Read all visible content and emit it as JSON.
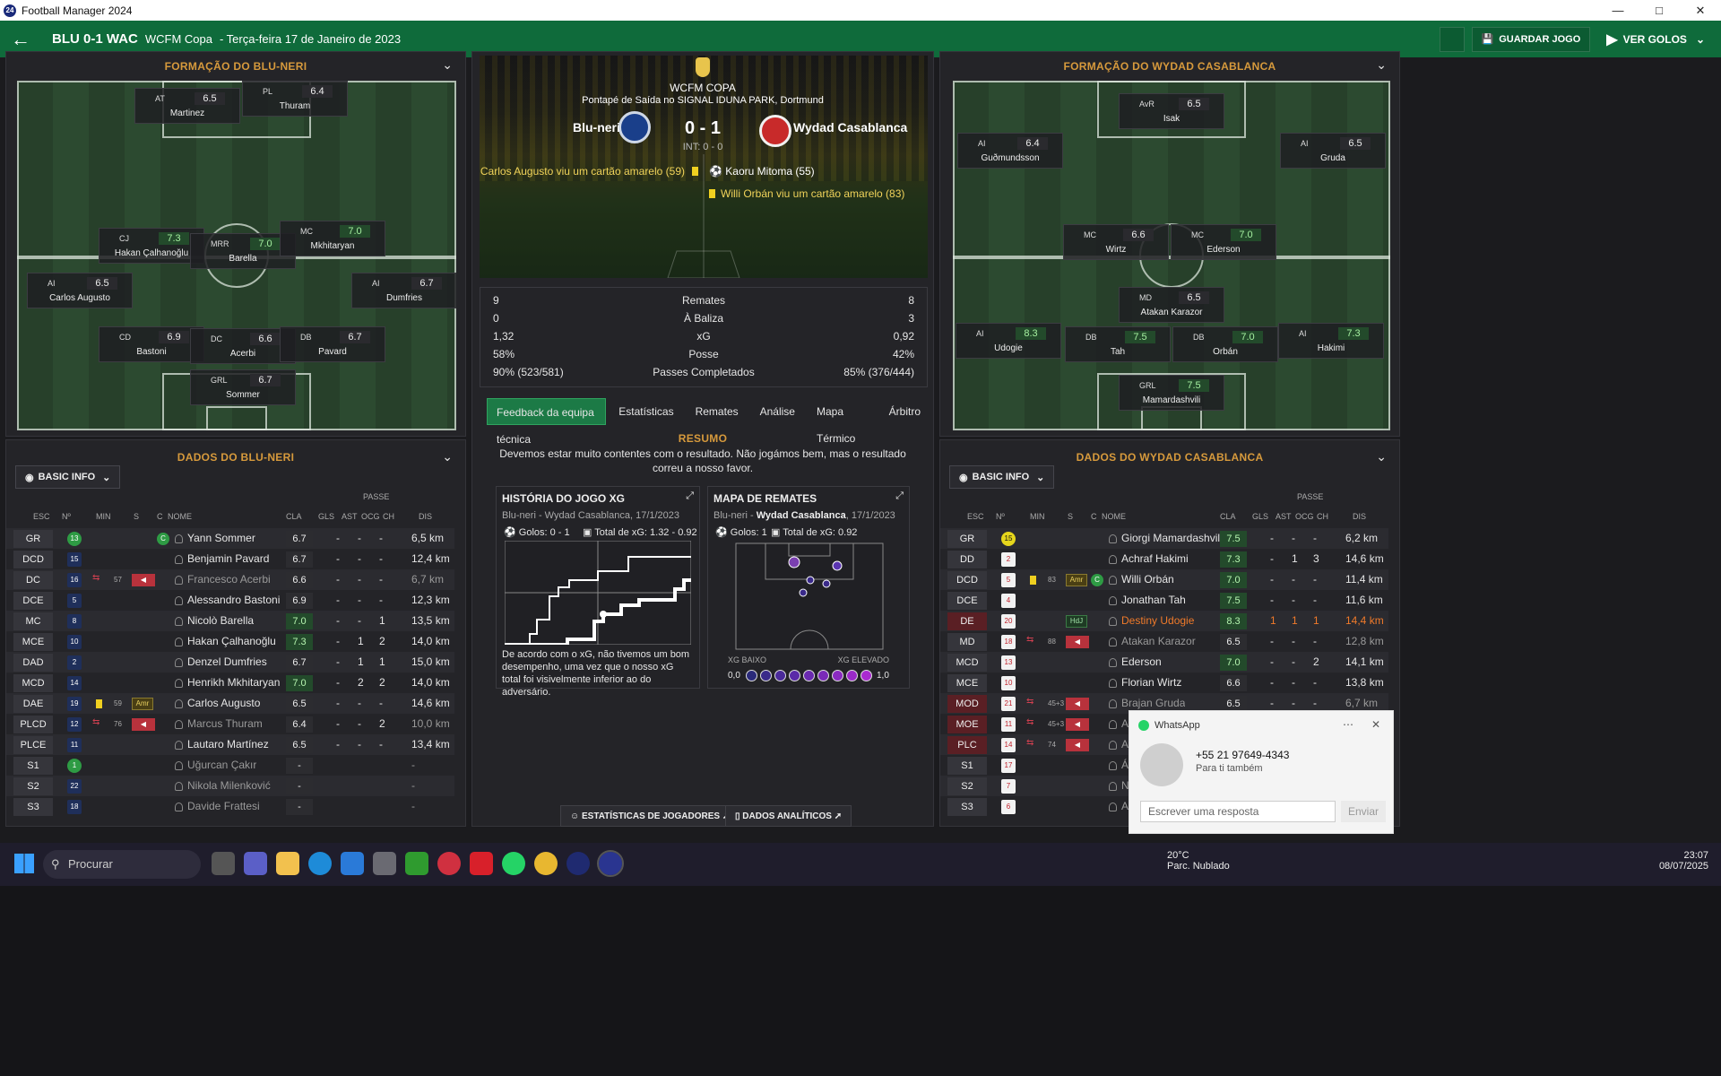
{
  "window": {
    "title": "Football Manager 2024",
    "app_icon": "24"
  },
  "header": {
    "score": "BLU 0-1 WAC",
    "competition": "WCFM Copa",
    "date": "- Terça-feira 17 de Janeiro de 2023",
    "save_label": "GUARDAR JOGO",
    "goals_label": "VER GOLOS"
  },
  "left": {
    "formation_title": "FORMAÇÃO DO BLU-NERI",
    "data_title": "DADOS DO BLU-NERI",
    "basic_info": "BASIC INFO",
    "players": [
      {
        "pos": "AT",
        "rating": "6.5",
        "name": "Martinez",
        "good": false
      },
      {
        "pos": "PL",
        "rating": "6.4",
        "name": "Thuram",
        "good": false
      },
      {
        "pos": "CJ",
        "rating": "7.3",
        "name": "Hakan Çalhanoğlu",
        "good": true
      },
      {
        "pos": "MRR",
        "rating": "7.0",
        "name": "Barella",
        "good": true
      },
      {
        "pos": "MC",
        "rating": "7.0",
        "name": "Mkhitaryan",
        "good": true
      },
      {
        "pos": "AI",
        "rating": "6.5",
        "name": "Carlos Augusto",
        "good": false
      },
      {
        "pos": "AI",
        "rating": "6.7",
        "name": "Dumfries",
        "good": false
      },
      {
        "pos": "CD",
        "rating": "6.9",
        "name": "Bastoni",
        "good": false
      },
      {
        "pos": "DC",
        "rating": "6.6",
        "name": "Acerbi",
        "good": false
      },
      {
        "pos": "DB",
        "rating": "6.7",
        "name": "Pavard",
        "good": false
      },
      {
        "pos": "GRL",
        "rating": "6.7",
        "name": "Sommer",
        "good": false
      }
    ],
    "columns": {
      "esc": "ESC",
      "n": "Nº",
      "min": "MIN",
      "s": "S",
      "c": "C",
      "nome": "NOME",
      "cla": "CLA",
      "gls": "GLS",
      "ast": "AST",
      "passe": "PASSE",
      "ocg": "OCG",
      "ch": "CH",
      "dis": "DIS"
    },
    "rows": [
      {
        "esc": "GR",
        "n": "13",
        "min": "",
        "cla": "6.7",
        "gls": "-",
        "ast": "-",
        "ocg": "-",
        "dis": "6,5 km",
        "name": "Yann Sommer",
        "sub": false,
        "yellow": false,
        "tag": "",
        "c": true,
        "gk": true,
        "red": false,
        "dim": false
      },
      {
        "esc": "DCD",
        "n": "15",
        "min": "",
        "cla": "6.7",
        "gls": "-",
        "ast": "-",
        "ocg": "-",
        "dis": "12,4 km",
        "name": "Benjamin Pavard",
        "sub": false,
        "yellow": false,
        "tag": "",
        "c": false,
        "gk": false,
        "red": false,
        "dim": false
      },
      {
        "esc": "DC",
        "n": "16",
        "min": "57",
        "cla": "6.6",
        "gls": "-",
        "ast": "-",
        "ocg": "-",
        "dis": "6,7 km",
        "name": "Francesco Acerbi",
        "sub": true,
        "yellow": false,
        "tag": "",
        "c": false,
        "gk": false,
        "red": false,
        "dim": true
      },
      {
        "esc": "DCE",
        "n": "5",
        "min": "",
        "cla": "6.9",
        "gls": "-",
        "ast": "-",
        "ocg": "-",
        "dis": "12,3 km",
        "name": "Alessandro Bastoni",
        "sub": false,
        "yellow": false,
        "tag": "",
        "c": false,
        "gk": false,
        "red": false,
        "dim": false
      },
      {
        "esc": "MC",
        "n": "8",
        "min": "",
        "cla": "7.0",
        "gls": "-",
        "ast": "-",
        "ocg": "1",
        "dis": "13,5 km",
        "name": "Nicolò Barella",
        "sub": false,
        "yellow": false,
        "tag": "",
        "c": false,
        "gk": false,
        "red": false,
        "dim": false
      },
      {
        "esc": "MCE",
        "n": "10",
        "min": "",
        "cla": "7.3",
        "gls": "-",
        "ast": "1",
        "ocg": "2",
        "dis": "14,0 km",
        "name": "Hakan Çalhanoğlu",
        "sub": false,
        "yellow": false,
        "tag": "",
        "c": false,
        "gk": false,
        "red": false,
        "dim": false
      },
      {
        "esc": "DAD",
        "n": "2",
        "min": "",
        "cla": "6.7",
        "gls": "-",
        "ast": "1",
        "ocg": "1",
        "dis": "15,0 km",
        "name": "Denzel Dumfries",
        "sub": false,
        "yellow": false,
        "tag": "",
        "c": false,
        "gk": false,
        "red": false,
        "dim": false
      },
      {
        "esc": "MCD",
        "n": "14",
        "min": "",
        "cla": "7.0",
        "gls": "-",
        "ast": "2",
        "ocg": "2",
        "dis": "14,0 km",
        "name": "Henrikh Mkhitaryan",
        "sub": false,
        "yellow": false,
        "tag": "",
        "c": false,
        "gk": false,
        "red": false,
        "dim": false
      },
      {
        "esc": "DAE",
        "n": "19",
        "min": "59",
        "cla": "6.5",
        "gls": "-",
        "ast": "-",
        "ocg": "-",
        "dis": "14,6 km",
        "name": "Carlos Augusto",
        "sub": false,
        "yellow": true,
        "tag": "Amr",
        "c": false,
        "gk": false,
        "red": false,
        "dim": false
      },
      {
        "esc": "PLCD",
        "n": "12",
        "min": "76",
        "cla": "6.4",
        "gls": "-",
        "ast": "-",
        "ocg": "2",
        "dis": "10,0 km",
        "name": "Marcus Thuram",
        "sub": true,
        "yellow": false,
        "tag": "",
        "c": false,
        "gk": false,
        "red": false,
        "dim": true
      },
      {
        "esc": "PLCE",
        "n": "11",
        "min": "",
        "cla": "6.5",
        "gls": "-",
        "ast": "-",
        "ocg": "-",
        "dis": "13,4 km",
        "name": "Lautaro Martínez",
        "sub": false,
        "yellow": false,
        "tag": "",
        "c": false,
        "gk": false,
        "red": false,
        "dim": false
      },
      {
        "esc": "S1",
        "n": "1",
        "min": "",
        "cla": "-",
        "gls": "",
        "ast": "",
        "ocg": "",
        "dis": "-",
        "name": "Uğurcan Çakır",
        "sub": false,
        "yellow": false,
        "tag": "",
        "c": false,
        "gk": true,
        "red": false,
        "dim": true
      },
      {
        "esc": "S2",
        "n": "22",
        "min": "",
        "cla": "-",
        "gls": "",
        "ast": "",
        "ocg": "",
        "dis": "-",
        "name": "Nikola Milenković",
        "sub": false,
        "yellow": false,
        "tag": "",
        "c": false,
        "gk": false,
        "red": false,
        "dim": true
      },
      {
        "esc": "S3",
        "n": "18",
        "min": "",
        "cla": "-",
        "gls": "",
        "ast": "",
        "ocg": "",
        "dis": "-",
        "name": "Davide Frattesi",
        "sub": false,
        "yellow": false,
        "tag": "",
        "c": false,
        "gk": false,
        "red": false,
        "dim": true
      }
    ]
  },
  "right": {
    "formation_title": "FORMAÇÃO DO WYDAD CASABLANCA",
    "data_title": "DADOS DO WYDAD CASABLANCA",
    "basic_info": "BASIC INFO",
    "players": [
      {
        "pos": "AvR",
        "rating": "6.5",
        "name": "Isak",
        "good": false
      },
      {
        "pos": "AI",
        "rating": "6.4",
        "name": "Guðmundsson",
        "good": false
      },
      {
        "pos": "AI",
        "rating": "6.5",
        "name": "Gruda",
        "good": false
      },
      {
        "pos": "MC",
        "rating": "6.6",
        "name": "Wirtz",
        "good": false
      },
      {
        "pos": "MC",
        "rating": "7.0",
        "name": "Ederson",
        "good": true
      },
      {
        "pos": "MD",
        "rating": "6.5",
        "name": "Atakan Karazor",
        "good": false
      },
      {
        "pos": "AI",
        "rating": "8.3",
        "name": "Udogie",
        "good": true
      },
      {
        "pos": "DB",
        "rating": "7.5",
        "name": "Tah",
        "good": true
      },
      {
        "pos": "DB",
        "rating": "7.0",
        "name": "Orbán",
        "good": true
      },
      {
        "pos": "AI",
        "rating": "7.3",
        "name": "Hakimi",
        "good": true
      },
      {
        "pos": "GRL",
        "rating": "7.5",
        "name": "Mamardashvili",
        "good": true
      }
    ],
    "rows": [
      {
        "esc": "GR",
        "n": "15",
        "min": "",
        "cla": "7.5",
        "gls": "-",
        "ast": "-",
        "ocg": "-",
        "dis": "6,2 km",
        "name": "Giorgi Mamardashvili",
        "sub": false,
        "yellow": false,
        "tag": "",
        "c": false,
        "gk": true,
        "red": false,
        "dim": false,
        "orange": false
      },
      {
        "esc": "DD",
        "n": "2",
        "min": "",
        "cla": "7.3",
        "gls": "-",
        "ast": "1",
        "ocg": "3",
        "dis": "14,6 km",
        "name": "Achraf Hakimi",
        "sub": false,
        "yellow": false,
        "tag": "",
        "c": false,
        "gk": false,
        "red": false,
        "dim": false,
        "orange": false
      },
      {
        "esc": "DCD",
        "n": "5",
        "min": "83",
        "cla": "7.0",
        "gls": "-",
        "ast": "-",
        "ocg": "-",
        "dis": "11,4 km",
        "name": "Willi Orbán",
        "sub": false,
        "yellow": true,
        "tag": "Amr",
        "c": true,
        "gk": false,
        "red": false,
        "dim": false,
        "orange": false
      },
      {
        "esc": "DCE",
        "n": "4",
        "min": "",
        "cla": "7.5",
        "gls": "-",
        "ast": "-",
        "ocg": "-",
        "dis": "11,6 km",
        "name": "Jonathan Tah",
        "sub": false,
        "yellow": false,
        "tag": "",
        "c": false,
        "gk": false,
        "red": false,
        "dim": false,
        "orange": false
      },
      {
        "esc": "DE",
        "n": "20",
        "min": "",
        "cla": "8.3",
        "gls": "1",
        "ast": "1",
        "ocg": "1",
        "dis": "14,4 km",
        "name": "Destiny Udogie",
        "sub": false,
        "yellow": false,
        "tag": "HdJ",
        "c": false,
        "gk": false,
        "red": true,
        "dim": false,
        "orange": true
      },
      {
        "esc": "MD",
        "n": "18",
        "min": "88",
        "cla": "6.5",
        "gls": "-",
        "ast": "-",
        "ocg": "-",
        "dis": "12,8 km",
        "name": "Atakan Karazor",
        "sub": true,
        "yellow": false,
        "tag": "",
        "c": false,
        "gk": false,
        "red": false,
        "dim": true,
        "orange": false
      },
      {
        "esc": "MCD",
        "n": "13",
        "min": "",
        "cla": "7.0",
        "gls": "-",
        "ast": "-",
        "ocg": "2",
        "dis": "14,1 km",
        "name": "Ederson",
        "sub": false,
        "yellow": false,
        "tag": "",
        "c": false,
        "gk": false,
        "red": false,
        "dim": false,
        "orange": false
      },
      {
        "esc": "MCE",
        "n": "10",
        "min": "",
        "cla": "6.6",
        "gls": "-",
        "ast": "-",
        "ocg": "-",
        "dis": "13,8 km",
        "name": "Florian Wirtz",
        "sub": false,
        "yellow": false,
        "tag": "",
        "c": false,
        "gk": false,
        "red": false,
        "dim": false,
        "orange": false
      },
      {
        "esc": "MOD",
        "n": "21",
        "min": "45+3",
        "cla": "6.5",
        "gls": "-",
        "ast": "-",
        "ocg": "-",
        "dis": "6,7 km",
        "name": "Brajan Gruda",
        "sub": true,
        "yellow": false,
        "tag": "",
        "c": false,
        "gk": false,
        "red": true,
        "dim": true,
        "orange": false
      },
      {
        "esc": "MOE",
        "n": "11",
        "min": "45+3",
        "cla": "",
        "gls": "",
        "ast": "",
        "ocg": "",
        "dis": "",
        "name": "All",
        "sub": true,
        "yellow": false,
        "tag": "",
        "c": false,
        "gk": false,
        "red": true,
        "dim": true,
        "orange": false
      },
      {
        "esc": "PLC",
        "n": "14",
        "min": "74",
        "cla": "",
        "gls": "",
        "ast": "",
        "ocg": "",
        "dis": "",
        "name": "Ale",
        "sub": true,
        "yellow": false,
        "tag": "",
        "c": false,
        "gk": false,
        "red": true,
        "dim": true,
        "orange": false
      },
      {
        "esc": "S1",
        "n": "17",
        "min": "",
        "cla": "",
        "gls": "",
        "ast": "",
        "ocg": "",
        "dis": "",
        "name": "Án",
        "sub": false,
        "yellow": false,
        "tag": "",
        "c": false,
        "gk": false,
        "red": false,
        "dim": true,
        "orange": false
      },
      {
        "esc": "S2",
        "n": "7",
        "min": "",
        "cla": "",
        "gls": "",
        "ast": "",
        "ocg": "",
        "dis": "",
        "name": "Nic",
        "sub": false,
        "yellow": false,
        "tag": "",
        "c": false,
        "gk": false,
        "red": false,
        "dim": true,
        "orange": false
      },
      {
        "esc": "S3",
        "n": "6",
        "min": "",
        "cla": "",
        "gls": "",
        "ast": "",
        "ocg": "",
        "dis": "",
        "name": "Ale",
        "sub": false,
        "yellow": false,
        "tag": "",
        "c": false,
        "gk": false,
        "red": false,
        "dim": true,
        "orange": false
      }
    ]
  },
  "match": {
    "competition": "WCFM COPA",
    "venue": "Pontapé de Saída no SIGNAL IDUNA PARK, Dortmund",
    "home": "Blu-neri",
    "away": "Wydad Casablanca",
    "score": "0 - 1",
    "halftime": "INT: 0 - 0",
    "events_home": [
      "Carlos Augusto viu um cartão amarelo (59)"
    ],
    "events_away": [
      "Kaoru Mitoma (55)",
      "Willi Orbán viu um cartão amarelo (83)"
    ],
    "stats": [
      {
        "l": "9",
        "m": "Remates",
        "r": "8"
      },
      {
        "l": "0",
        "m": "À Baliza",
        "r": "3"
      },
      {
        "l": "1,32",
        "m": "xG",
        "r": "0,92"
      },
      {
        "l": "58%",
        "m": "Posse",
        "r": "42%"
      },
      {
        "l": "90% (523/581)",
        "m": "Passes Completados",
        "r": "85% (376/444)"
      }
    ],
    "tabs": [
      "Feedback da equipa técnica",
      "Estatísticas",
      "Remates",
      "Análise",
      "Mapa Térmico",
      "Árbitro"
    ],
    "summary_title": "RESUMO",
    "summary": "Devemos estar muito contentes com o resultado. Não jogámos bem, mas o resultado correu a nosso favor.",
    "xg_card": {
      "title": "HISTÓRIA DO JOGO XG",
      "sub": "Blu-neri - Wydad Casablanca, 17/1/2023",
      "goals": "Golos: 0 - 1",
      "total": "Total de xG: 1.32 - 0.92",
      "text": "De acordo com o xG, não tivemos um bom desempenho, uma vez que o nosso xG total foi visivelmente inferior ao do adversário."
    },
    "shot_card": {
      "title": "MAPA DE REMATES",
      "sub_pre": "Blu-neri - ",
      "sub_team": "Wydad Casablanca",
      "sub_post": ", 17/1/2023",
      "goals": "Golos: 1",
      "total": "Total de xG: 0.92",
      "low": "XG BAIXO",
      "high": "XG ELEVADO",
      "min": "0,0",
      "max": "1,0"
    },
    "btn_players": "ESTATÍSTICAS DE JOGADORES",
    "btn_analytics": "DADOS ANALÍTICOS"
  },
  "whatsapp": {
    "app": "WhatsApp",
    "number": "+55 21 97649-4343",
    "subtitle": "Para ti também",
    "placeholder": "Escrever uma resposta",
    "send": "Enviar"
  },
  "taskbar": {
    "search": "Procurar",
    "temp": "20°C",
    "weather": "Parc. Nublado",
    "time": "23:07",
    "date": "08/07/2025"
  },
  "colors": {
    "accent": "#0f6b3b",
    "title_orange": "#d79a3c",
    "rating_good": "#a5f0a0"
  }
}
